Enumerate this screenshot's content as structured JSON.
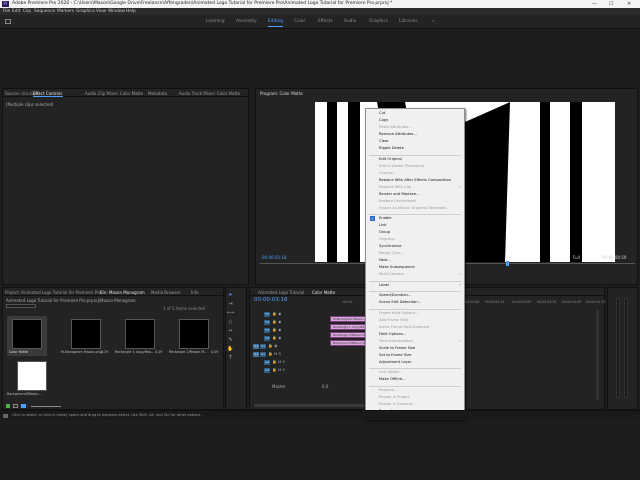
{
  "window": {
    "title": "Adobe Premiere Pro 2020 - C:\\Users\\Mason\\Google Drive\\Freelance\\Affengraden\\Animated Logo Tutorial for Premiere Pro\\Animated Logo Tutorial for Premiere Pro.prproj *",
    "app_icon": "Pr",
    "minimize": "—",
    "maximize": "☐",
    "close": "✕"
  },
  "menubar": [
    "File",
    "Edit",
    "Clip",
    "Sequence",
    "Markers",
    "Graphics",
    "View",
    "Window",
    "Help"
  ],
  "workspaces": {
    "items": [
      "Learning",
      "Assembly",
      "Editing",
      "Color",
      "Effects",
      "Audio",
      "Graphics",
      "Libraries"
    ],
    "active_index": 2,
    "more": "»"
  },
  "source_panel": {
    "tabs": [
      "Source: (no clips)",
      "Effect Controls",
      "Audio Clip Mixer: Color Matte",
      "Metadata",
      "Audio Track Mixer: Color Matte"
    ],
    "active_tab": 1,
    "message": "(Multiple clips selected)"
  },
  "program": {
    "title": "Program: Color Matte",
    "timecode_left": "00:00:03:18",
    "fit": "Full",
    "timecode_right": "00:00:04:59"
  },
  "project_panel": {
    "tabs": [
      "Project: Animated Logo Tutorial for Premiere Pro",
      "Bin: Mason Monogram",
      "Media Browser",
      "Info"
    ],
    "active_tab": 1,
    "path": "Animated Logo Tutorial for Premiere Pro.prproj\\Mason Monogram",
    "selection_count": "1 of 5 items selected",
    "items": [
      {
        "name": "Color Matte",
        "duration": "0;29"
      },
      {
        "name": "M-Monogram Mason.png",
        "duration": "0;29"
      },
      {
        "name": "Rectangle 1 copy/Mas...",
        "duration": "0;29"
      },
      {
        "name": "Rectangle 2/Mason M...",
        "duration": "0;29"
      },
      {
        "name": "Background/Mason...",
        "duration": "0;29"
      }
    ]
  },
  "timeline": {
    "tabs": [
      "Animated Logo Tutorial",
      "Color Matte"
    ],
    "active_tab": 1,
    "timecode": "00:00:03:18",
    "ruler": [
      ":00:00",
      "00:00:00:15",
      "00:00:01:00",
      "00:00:01:15",
      "00:00:02:00",
      "00:00:02:15",
      "00:00:03:00",
      "00:00:03:15",
      "00:00:04:00",
      "00:00:04:15"
    ],
    "video_tracks": [
      "V5",
      "V4",
      "V3",
      "V2",
      "V1"
    ],
    "audio_tracks": [
      "A1",
      "A2",
      "A3"
    ],
    "master_label": "Master",
    "master_value": "0.0",
    "clips": [
      "M-Monogram Mason.png",
      "Rectangle 1 copy/Mas",
      "Rectangle 2/Mason M",
      "Background/Mason M"
    ]
  },
  "context_menu": {
    "items": [
      {
        "label": "Cut",
        "enabled": true
      },
      {
        "label": "Copy",
        "enabled": true
      },
      {
        "label": "Paste Attributes...",
        "enabled": false
      },
      {
        "label": "Remove Attributes...",
        "enabled": true
      },
      {
        "label": "Clear",
        "enabled": true
      },
      {
        "label": "Ripple Delete",
        "enabled": true
      },
      {
        "sep": true
      },
      {
        "label": "Edit Original",
        "enabled": true
      },
      {
        "label": "Edit in Adobe Photoshop",
        "enabled": false
      },
      {
        "label": "License...",
        "enabled": false
      },
      {
        "label": "Replace With After Effects Composition",
        "enabled": true
      },
      {
        "label": "Replace With Clip",
        "enabled": false,
        "submenu": true
      },
      {
        "label": "Render and Replace...",
        "enabled": true
      },
      {
        "label": "Restore Unrendered",
        "enabled": false
      },
      {
        "label": "Export As Motion Graphics Template...",
        "enabled": false
      },
      {
        "sep": true
      },
      {
        "label": "Enable",
        "enabled": true,
        "checked": true
      },
      {
        "label": "Link",
        "enabled": true
      },
      {
        "label": "Group",
        "enabled": true
      },
      {
        "label": "Ungroup",
        "enabled": false
      },
      {
        "label": "Synchronize",
        "enabled": true
      },
      {
        "label": "Merge Clips...",
        "enabled": false
      },
      {
        "label": "Nest...",
        "enabled": true
      },
      {
        "label": "Make Subsequence",
        "enabled": true
      },
      {
        "label": "Multi-Camera",
        "enabled": false,
        "submenu": true
      },
      {
        "sep": true
      },
      {
        "label": "Label",
        "enabled": true,
        "submenu": true
      },
      {
        "sep": true
      },
      {
        "label": "Speed/Duration...",
        "enabled": true
      },
      {
        "label": "Scene Edit Detection...",
        "enabled": true
      },
      {
        "sep": true
      },
      {
        "label": "Frame Hold Options...",
        "enabled": false
      },
      {
        "label": "Add Frame Hold",
        "enabled": false
      },
      {
        "label": "Insert Frame Hold Segment",
        "enabled": false
      },
      {
        "label": "Field Options...",
        "enabled": true
      },
      {
        "label": "Time Interpolation",
        "enabled": false,
        "submenu": true
      },
      {
        "label": "Scale to Frame Size",
        "enabled": true
      },
      {
        "label": "Set to Frame Size",
        "enabled": true
      },
      {
        "label": "Adjustment Layer",
        "enabled": true
      },
      {
        "sep": true
      },
      {
        "label": "Link Media...",
        "enabled": false
      },
      {
        "label": "Make Offline...",
        "enabled": true
      },
      {
        "sep": true
      },
      {
        "label": "Rename...",
        "enabled": false
      },
      {
        "label": "Reveal in Project",
        "enabled": false
      },
      {
        "label": "Reveal in Explorer...",
        "enabled": false
      },
      {
        "label": "Properties",
        "enabled": true
      }
    ]
  },
  "statusbar": {
    "hint": "Click to select, or click in empty space and drag to marquee select. Use Shift, Alt, and Ctrl for other options."
  },
  "colors": {
    "accent": "#4d9fff",
    "clip": "#d7a6d9",
    "menu_bg": "#f0f0f0"
  }
}
